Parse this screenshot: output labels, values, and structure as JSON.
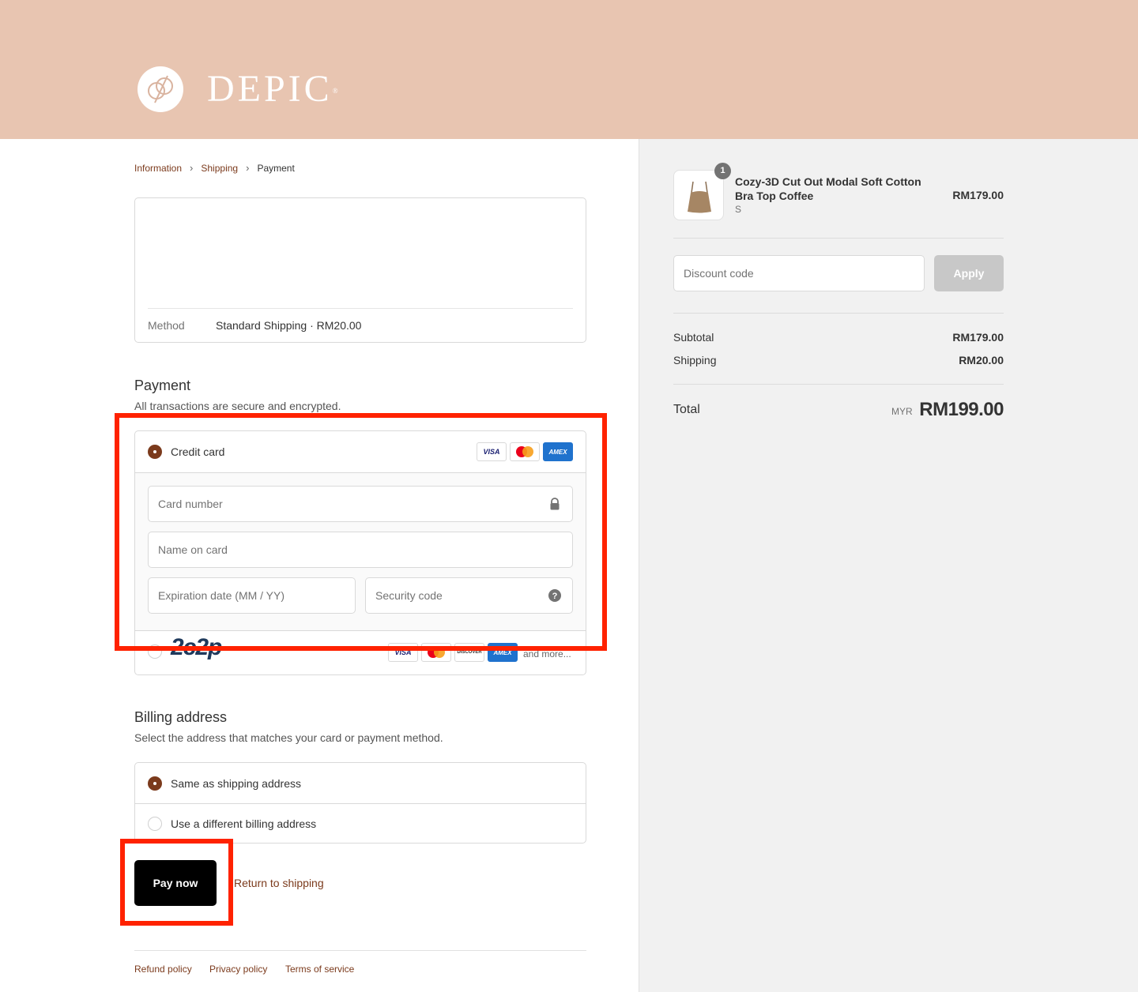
{
  "brand": {
    "name": "DEPIC",
    "mark": "®"
  },
  "breadcrumb": {
    "step1": "Information",
    "step2": "Shipping",
    "step3": "Payment"
  },
  "shipping_summary": {
    "method_label": "Method",
    "method_value": "Standard Shipping · RM20.00"
  },
  "payment": {
    "title": "Payment",
    "subtitle": "All transactions are secure and encrypted.",
    "credit_card": {
      "label": "Credit card",
      "selected": true,
      "logos": [
        "VISA",
        "mastercard",
        "AMEX"
      ],
      "card_number_placeholder": "Card number",
      "name_placeholder": "Name on card",
      "expiry_placeholder": "Expiration date (MM / YY)",
      "cvv_placeholder": "Security code"
    },
    "alt_gateway": {
      "label": "2c2p",
      "selected": false,
      "logos": [
        "VISA",
        "mastercard",
        "DISCOVER",
        "AMEX"
      ],
      "more": "and more..."
    }
  },
  "billing": {
    "title": "Billing address",
    "subtitle": "Select the address that matches your card or payment method.",
    "options": [
      {
        "label": "Same as shipping address",
        "selected": true
      },
      {
        "label": "Use a different billing address",
        "selected": false
      }
    ]
  },
  "actions": {
    "pay_now": "Pay now",
    "return": "Return to shipping"
  },
  "footer_links": [
    "Refund policy",
    "Privacy policy",
    "Terms of service"
  ],
  "order": {
    "item": {
      "quantity": "1",
      "name": "Cozy-3D Cut Out Modal Soft Cotton Bra Top Coffee",
      "variant": "S",
      "price": "RM179.00"
    },
    "discount": {
      "placeholder": "Discount code",
      "apply": "Apply"
    },
    "subtotal_label": "Subtotal",
    "subtotal_value": "RM179.00",
    "shipping_label": "Shipping",
    "shipping_value": "RM20.00",
    "total_label": "Total",
    "currency": "MYR",
    "total_value": "RM199.00"
  },
  "colors": {
    "banner": "#e8c5b1",
    "accent": "#7b3a1c",
    "highlight": "#ff2200"
  }
}
